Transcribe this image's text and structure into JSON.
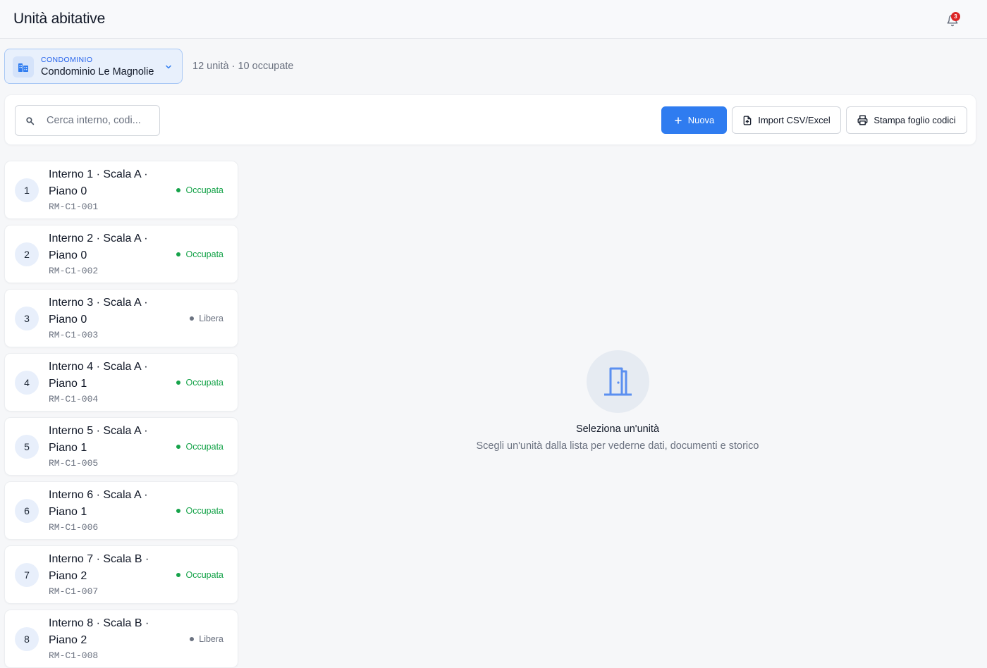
{
  "header": {
    "title": "Unità abitative",
    "notifications_count": "3"
  },
  "condo": {
    "caption": "CONDOMINIO",
    "name": "Condominio Le Magnolie",
    "summary": "12 unità · 10 occupate"
  },
  "toolbar": {
    "search_placeholder": "Cerca interno, codi...",
    "new_label": "Nuova",
    "import_label": "Import CSV/Excel",
    "print_label": "Stampa foglio codici"
  },
  "units": [
    {
      "num": "1",
      "line1": "Interno 1 · Scala A ·",
      "line2": "Piano 0",
      "code": "RM-C1-001",
      "status": "Occupata",
      "occupied": true
    },
    {
      "num": "2",
      "line1": "Interno 2 · Scala A ·",
      "line2": "Piano 0",
      "code": "RM-C1-002",
      "status": "Occupata",
      "occupied": true
    },
    {
      "num": "3",
      "line1": "Interno 3 · Scala A ·",
      "line2": "Piano 0",
      "code": "RM-C1-003",
      "status": "Libera",
      "occupied": false
    },
    {
      "num": "4",
      "line1": "Interno 4 · Scala A ·",
      "line2": "Piano 1",
      "code": "RM-C1-004",
      "status": "Occupata",
      "occupied": true
    },
    {
      "num": "5",
      "line1": "Interno 5 · Scala A ·",
      "line2": "Piano 1",
      "code": "RM-C1-005",
      "status": "Occupata",
      "occupied": true
    },
    {
      "num": "6",
      "line1": "Interno 6 · Scala A ·",
      "line2": "Piano 1",
      "code": "RM-C1-006",
      "status": "Occupata",
      "occupied": true
    },
    {
      "num": "7",
      "line1": "Interno 7 · Scala B ·",
      "line2": "Piano 2",
      "code": "RM-C1-007",
      "status": "Occupata",
      "occupied": true
    },
    {
      "num": "8",
      "line1": "Interno 8 · Scala B ·",
      "line2": "Piano 2",
      "code": "RM-C1-008",
      "status": "Libera",
      "occupied": false
    }
  ],
  "empty_state": {
    "title": "Seleziona un'unità",
    "subtitle": "Scegli un'unità dalla lista per vederne dati, documenti e storico"
  },
  "colors": {
    "accent": "#2f7cf0",
    "occupied": "#16a34a",
    "free": "#6b7280",
    "badge": "#dc2626"
  },
  "icons": {
    "bell": "bell-icon",
    "building": "building-icon",
    "chevron": "chevron-down-icon",
    "search": "search-icon",
    "plus": "plus-icon",
    "file_import": "file-import-icon",
    "printer": "printer-icon",
    "door": "door-icon"
  }
}
